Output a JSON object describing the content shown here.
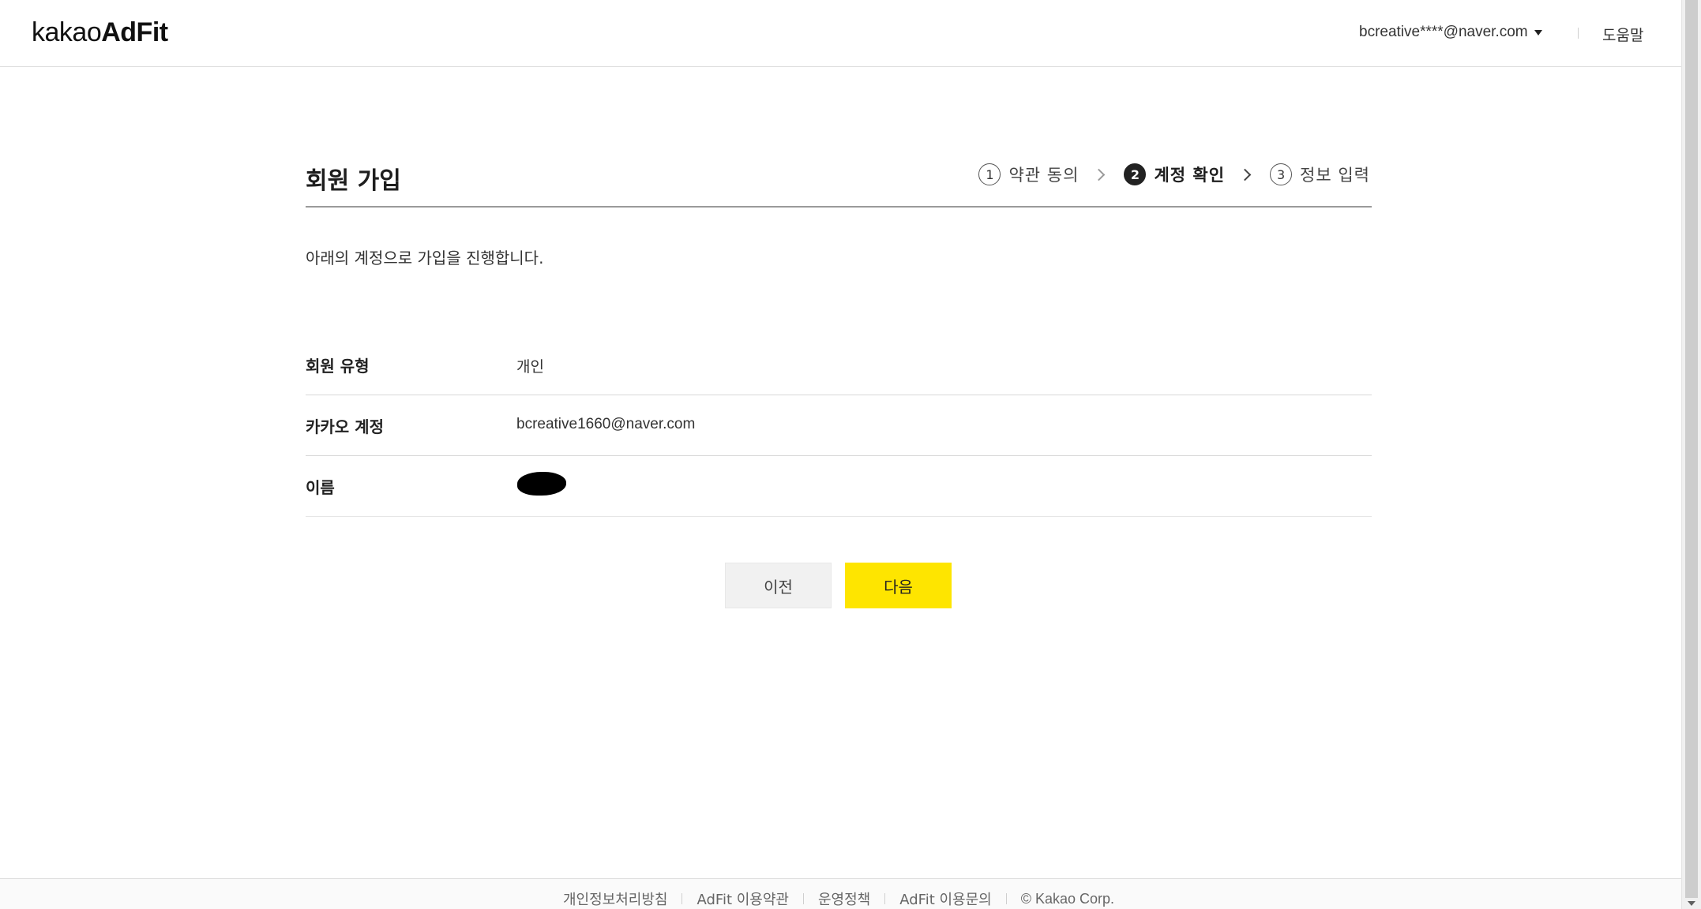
{
  "header": {
    "logo_light": "kakao",
    "logo_bold": "AdFit",
    "account": "bcreative****@naver.com",
    "help": "도움말"
  },
  "main": {
    "title": "회원 가입",
    "steps": [
      {
        "num": "1",
        "label": "약관 동의",
        "active": false
      },
      {
        "num": "2",
        "label": "계정 확인",
        "active": true
      },
      {
        "num": "3",
        "label": "정보 입력",
        "active": false
      }
    ],
    "intro": "아래의 계정으로 가입을 진행합니다.",
    "rows": [
      {
        "label": "회원 유형",
        "value": "개인"
      },
      {
        "label": "카카오 계정",
        "value": "bcreative1660@naver.com"
      },
      {
        "label": "이름",
        "value": ""
      }
    ],
    "prev_label": "이전",
    "next_label": "다음"
  },
  "footer": {
    "links": [
      "개인정보처리방침",
      "AdFit 이용약관",
      "운영정책",
      "AdFit 이용문의"
    ],
    "copyright": "© Kakao Corp."
  },
  "colors": {
    "accent": "#fee500",
    "border": "#d7d7d7",
    "title_rule": "#9a9a9a"
  },
  "icons": [
    "caret-down-icon",
    "chevron-right-icon",
    "step-number-icon"
  ]
}
